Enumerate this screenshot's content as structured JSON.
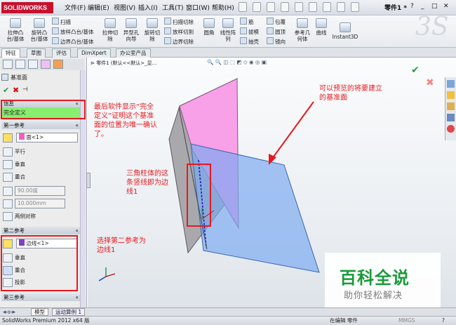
{
  "app": {
    "logo": "SOLIDWORKS",
    "doc_title": "零件1 *",
    "help": "?"
  },
  "menu": [
    "文件(F)",
    "编辑(E)",
    "视图(V)",
    "插入(I)",
    "工具(T)",
    "窗口(W)",
    "帮助(H)"
  ],
  "ribbon": {
    "big": [
      "拉伸凸\n台/基体",
      "旋转凸\n台/基体",
      "拉伸切\n除",
      "异型孔\n向导",
      "旋转切\n除",
      "圆角",
      "线性阵\n列",
      "参考几\n何体",
      "曲线",
      "Instant3D"
    ],
    "small": [
      "扫描",
      "放样凸台/基体",
      "边界凸台/基体",
      "扫描切除",
      "放样切割",
      "边界切除",
      "筋",
      "拔模",
      "抽壳",
      "包覆",
      "圆顶",
      "镜向"
    ]
  },
  "tabs": [
    "特征",
    "草图",
    "评估",
    "DimXpert",
    "办公室产品"
  ],
  "panel": {
    "title": "基准面",
    "message_header": "信息",
    "message": "完全定义",
    "ref1_header": "第一参考",
    "ref1_value": "面<1>",
    "ref1_opts": [
      "平行",
      "垂直",
      "重合"
    ],
    "angle": "90.00度",
    "distance": "10.000mm",
    "flip": "两侧对称",
    "ref2_header": "第二参考",
    "ref2_value": "边线<1>",
    "ref2_opts": [
      "垂直",
      "重合",
      "投影"
    ],
    "ref3_header": "第三参考"
  },
  "tree": {
    "label": "零件1 (默认<<默认>_显..."
  },
  "annotations": {
    "a1": "最后软件显示“完全\n定义”证明这个基准\n面的位置为唯一确认\n了。",
    "a2": "可以预览的将要建立\n的基准面",
    "a3": "三角柱体的这\n条竖线即为边\n线1",
    "a4": "选择第二参考为\n边线1"
  },
  "bottom_tabs": [
    "模型",
    "运动算例 1"
  ],
  "status": {
    "left": "SolidWorks Premium 2012 x64 版",
    "mid": "在编辑 零件",
    "right": "MMGS"
  },
  "watermark": {
    "main": "百科全说",
    "sub": "助你轻松解决"
  },
  "colors": {
    "accent": "#e6191e",
    "ok": "#1a9a3a",
    "plane": "#7aaaf0"
  }
}
